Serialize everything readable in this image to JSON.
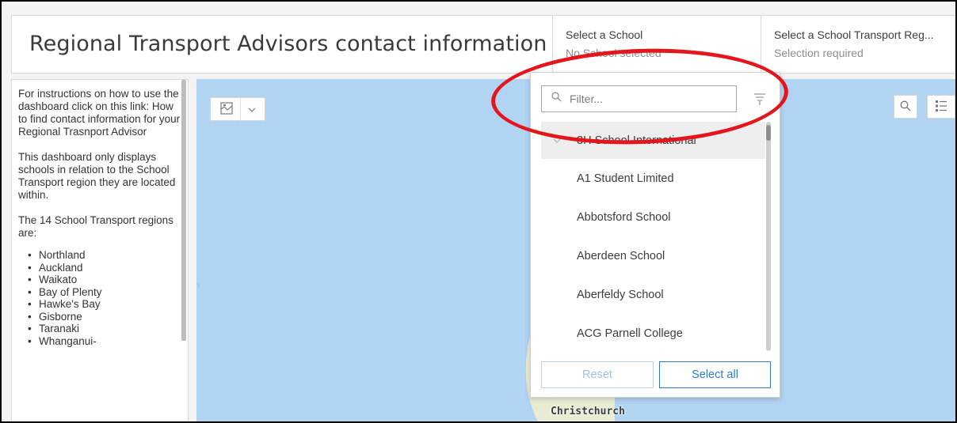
{
  "header": {
    "title": "Regional Transport Advisors contact information",
    "selector_school": {
      "label": "Select a School",
      "value": "No School selected"
    },
    "selector_region": {
      "label": "Select a School Transport Reg...",
      "value": "Selection required"
    }
  },
  "left_panel": {
    "paragraphs": [
      "For instructions on how to use the dashboard click on this link: How to find contact information for your Regional Trasnport Advisor",
      "This dashboard only displays schools in relation to the School Transport region they are located within.",
      "The 14 School Transport regions are:"
    ],
    "regions": [
      "Northland",
      "Auckland",
      "Waikato",
      "Bay of Plenty",
      "Hawke's Bay",
      "Gisborne",
      "Taranaki",
      "Whanganui-"
    ]
  },
  "map": {
    "city_label": "Christchurch",
    "faint_label": "an",
    "icons": {
      "basemap": "basemap-gallery-icon",
      "search": "search-icon",
      "legend": "legend-list-icon"
    }
  },
  "dropdown": {
    "filter_placeholder": "Filter...",
    "items": [
      {
        "label": "3H School International",
        "selected": true
      },
      {
        "label": "A1 Student Limited",
        "selected": false
      },
      {
        "label": "Abbotsford School",
        "selected": false
      },
      {
        "label": "Aberdeen School",
        "selected": false
      },
      {
        "label": "Aberfeldy School",
        "selected": false
      },
      {
        "label": "ACG Parnell College",
        "selected": false
      }
    ],
    "reset_label": "Reset",
    "select_all_label": "Select all"
  },
  "colors": {
    "accent": "#2f7cc4",
    "annotation": "#e4161d",
    "water": "#b2d4f3",
    "land": "#e9ecd2"
  }
}
